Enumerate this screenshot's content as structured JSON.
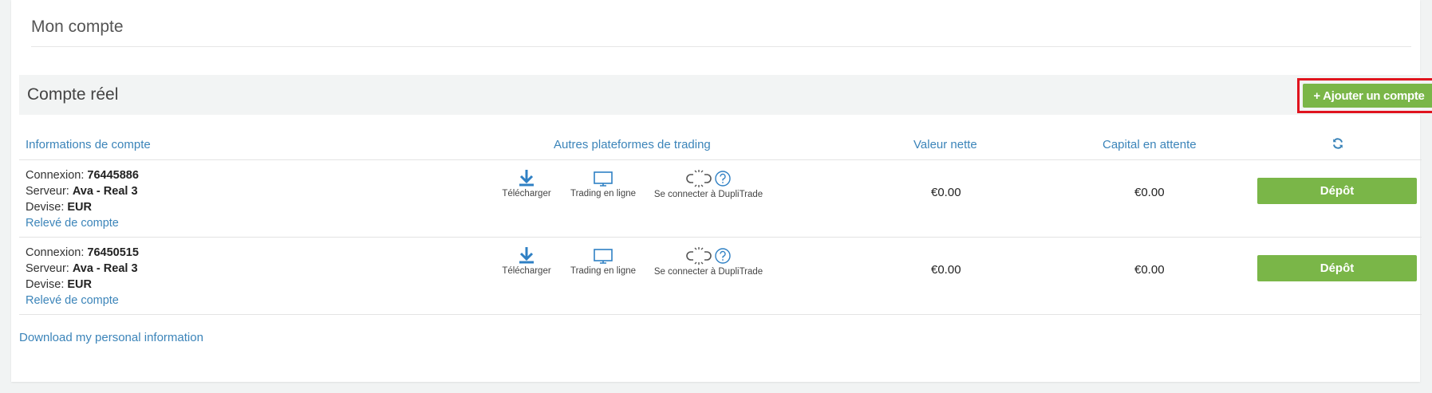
{
  "header": {
    "title": "Mon compte"
  },
  "section": {
    "title": "Compte réel",
    "add_label": "+ Ajouter un compte"
  },
  "table": {
    "columns": {
      "info": "Informations de compte",
      "platforms": "Autres plateformes de trading",
      "net": "Valeur nette",
      "pending": "Capital en attente"
    },
    "rows": [
      {
        "login_label": "Connexion:",
        "login": "76445886",
        "server_label": "Serveur:",
        "server": "Ava - Real 3",
        "currency_label": "Devise:",
        "currency": "EUR",
        "statement": "Relevé de compte",
        "download": "Télécharger",
        "online": "Trading en ligne",
        "duplitrade": "Se connecter à DupliTrade",
        "net": "€0.00",
        "pending": "€0.00",
        "deposit": "Dépôt"
      },
      {
        "login_label": "Connexion:",
        "login": "76450515",
        "server_label": "Serveur:",
        "server": "Ava - Real 3",
        "currency_label": "Devise:",
        "currency": "EUR",
        "statement": "Relevé de compte",
        "download": "Télécharger",
        "online": "Trading en ligne",
        "duplitrade": "Se connecter à DupliTrade",
        "net": "€0.00",
        "pending": "€0.00",
        "deposit": "Dépôt"
      }
    ]
  },
  "footer": {
    "link": "Download my personal information"
  },
  "colors": {
    "accent": "#7ab648",
    "link": "#3b84b9",
    "highlight": "#e0141e"
  },
  "icons": [
    "refresh-icon",
    "download-icon",
    "monitor-icon",
    "broken-link-icon",
    "help-icon"
  ]
}
